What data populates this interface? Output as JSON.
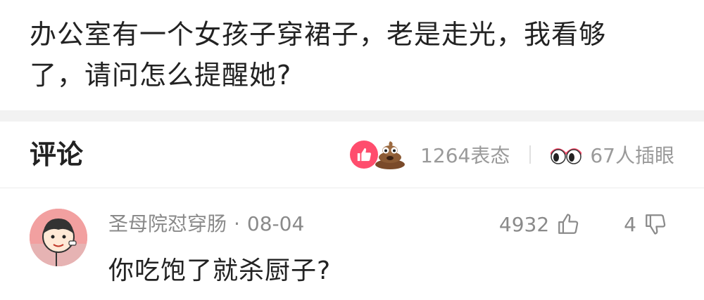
{
  "post": {
    "line1": "办公室有一个女孩子穿裙子，老是走光，我看够",
    "line2": "了，请问怎么提醒她?"
  },
  "comments_section": {
    "title": "评论",
    "reaction_count": "1264表态",
    "peek_count": "67人插眼",
    "icons": [
      "thumbs-up-icon",
      "poop-emoji-icon",
      "peeking-eyes-icon"
    ]
  },
  "comment": {
    "author": "圣母院怼穿肠",
    "separator": "·",
    "date": "08-04",
    "text": "你吃饱了就杀厨子?",
    "up_count": "4932",
    "down_count": "4"
  },
  "colors": {
    "accent": "#ff4d6d",
    "text": "#222222",
    "muted": "#8a8a8a"
  }
}
